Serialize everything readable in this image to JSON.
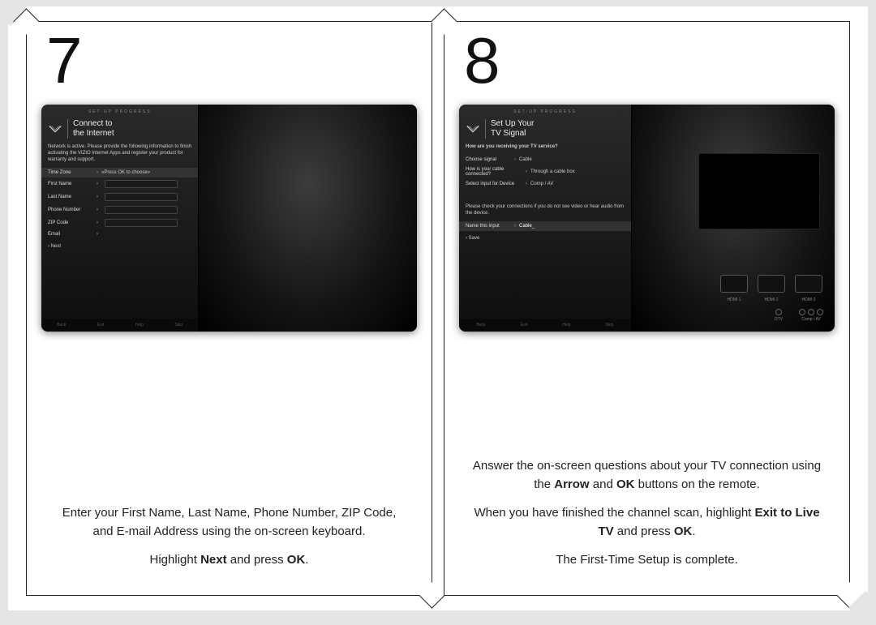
{
  "panel7": {
    "step": "7",
    "tv": {
      "header": "SET-UP PROGRESS",
      "title_line1": "Connect to",
      "title_line2": "the Internet",
      "desc": "Network is active. Please provide the following information to finish activating the VIZIO Internet Apps and register your product for warranty and support.",
      "rows": {
        "time_zone_label": "Time Zone",
        "time_zone_value": "«Press OK to choose»",
        "first_name": "First Name",
        "last_name": "Last Name",
        "phone": "Phone Number",
        "zip": "ZIP Code",
        "email": "Email",
        "next": "Next"
      },
      "footer": {
        "back": "Back",
        "exit": "Exit",
        "help": "Help",
        "skip": "Skip"
      }
    },
    "text": {
      "p1": "Enter your First Name, Last Name, Phone Number, ZIP Code, and E-mail Address using the on-screen keyboard.",
      "p2_pre": "Highlight ",
      "p2_b": "Next",
      "p2_post": " and press ",
      "p2_b2": "OK",
      "p2_end": "."
    }
  },
  "panel8": {
    "step": "8",
    "tv": {
      "header": "SET-UP PROGRESS",
      "title_line1": "Set Up Your",
      "title_line2": "TV Signal",
      "q": "How are you receiving your TV service?",
      "rows": {
        "choose_signal_l": "Choose signal",
        "choose_signal_v": "Cable",
        "how_connected_l": "How is your cable connected?",
        "how_connected_v": "Through a cable box",
        "select_input_l": "Select input for Device",
        "select_input_v": "Comp / AV",
        "note": "Please check your connections if you do not see video or hear audio from the device.",
        "name_input_l": "Name this input",
        "name_input_v": "Cable_",
        "save": "Save"
      },
      "inputs": {
        "hdmi1": "HDMI 1",
        "hdmi2": "HDMI 2",
        "hdmi3": "HDMI 3",
        "dtv": "DTV",
        "compav": "Comp / AV"
      },
      "footer": {
        "back": "Back",
        "exit": "Exit",
        "help": "Help",
        "skip": "Skip"
      }
    },
    "text": {
      "p1_pre": "Answer the on-screen questions about your TV connection using the ",
      "p1_b1": "Arrow",
      "p1_mid": " and ",
      "p1_b2": "OK",
      "p1_post": " buttons on the remote.",
      "p2_pre": "When you have finished the channel scan, highlight ",
      "p2_b": "Exit to Live TV",
      "p2_mid": " and press ",
      "p2_b2": "OK",
      "p2_end": ".",
      "p3": "The First-Time Setup is complete."
    }
  }
}
